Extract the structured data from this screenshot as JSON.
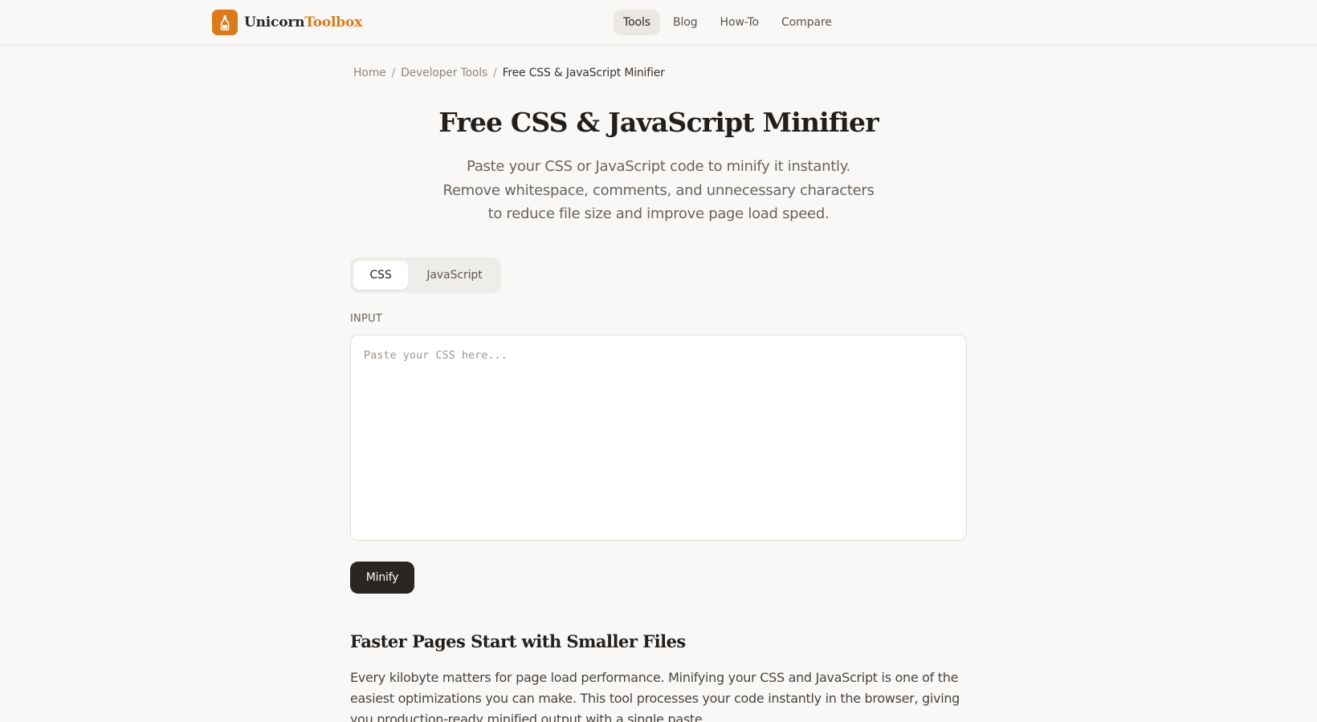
{
  "brand": {
    "name_primary": "Unicorn",
    "name_accent": "Toolbox",
    "logo_icon": "bottle-icon",
    "accent_color": "#d97a1c"
  },
  "nav": {
    "items": [
      {
        "label": "Tools",
        "active": true
      },
      {
        "label": "Blog",
        "active": false
      },
      {
        "label": "How-To",
        "active": false
      },
      {
        "label": "Compare",
        "active": false
      }
    ]
  },
  "breadcrumb": {
    "items": [
      "Home",
      "Developer Tools",
      "Free CSS & JavaScript Minifier"
    ],
    "separator": "/"
  },
  "hero": {
    "title": "Free CSS & JavaScript Minifier",
    "subtitle_lines": [
      "Paste your CSS or JavaScript code to minify it instantly.",
      "Remove whitespace, comments, and unnecessary characters",
      "to reduce file size and improve page load speed."
    ]
  },
  "tabs": {
    "items": [
      {
        "label": "CSS",
        "active": true
      },
      {
        "label": "JavaScript",
        "active": false
      }
    ]
  },
  "editor": {
    "label": "INPUT",
    "value": "",
    "placeholder": "Paste your CSS here...",
    "button_label": "Minify"
  },
  "article": {
    "heading": "Faster Pages Start with Smaller Files",
    "body": "Every kilobyte matters for page load performance. Minifying your CSS and JavaScript is one of the easiest optimizations you can make. This tool processes your code instantly in the browser, giving you production-ready minified output with a single paste."
  }
}
